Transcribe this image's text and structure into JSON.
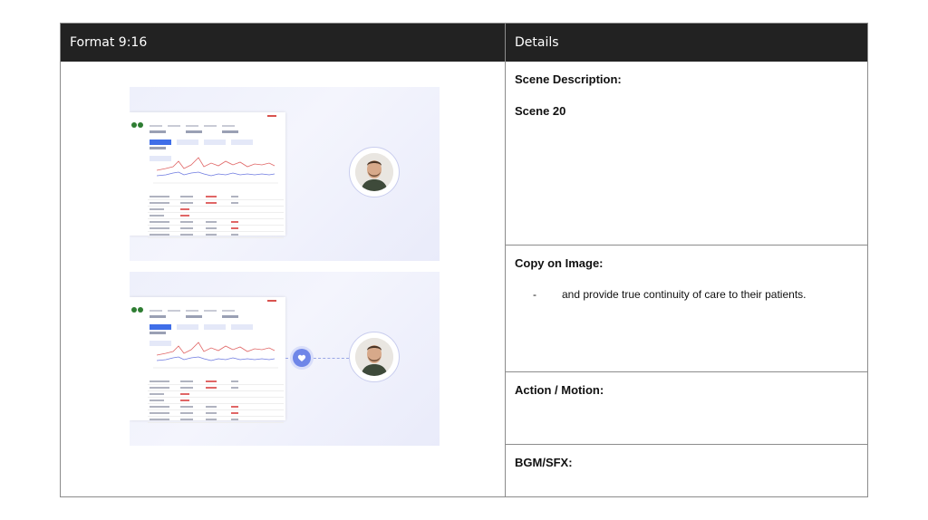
{
  "header": {
    "left_title": "Format 9:16",
    "right_title": "Details"
  },
  "details": {
    "scene_description_label": "Scene Description:",
    "scene_value": "Scene 20",
    "copy_label": "Copy on Image:",
    "copy_bullet": "-",
    "copy_text": "and provide true continuity of care to their patients.",
    "action_label": "Action / Motion:",
    "bgm_label": "BGM/SFX:"
  },
  "colors": {
    "header_bg": "#222222",
    "border": "#8c8c8c",
    "accent_blue": "#3f6ee8",
    "chart_red": "#e06666",
    "chart_blue": "#6f7be0"
  }
}
